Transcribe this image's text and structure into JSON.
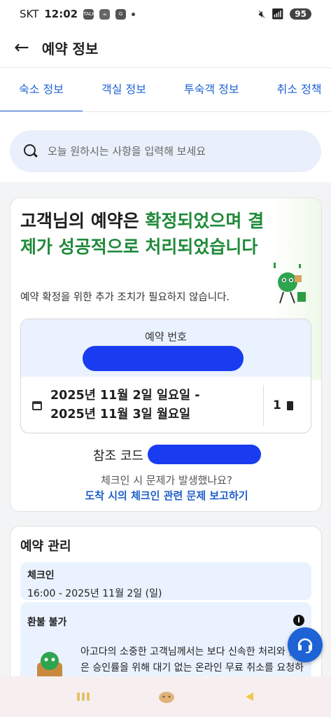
{
  "status_bar": {
    "carrier": "SKT",
    "time": "12:02",
    "talk_icon": "TALK",
    "battery": "95"
  },
  "appbar": {
    "title": "예약 정보"
  },
  "tabs": [
    {
      "label": "숙소 정보",
      "active": true
    },
    {
      "label": "객실 정보",
      "active": false
    },
    {
      "label": "투숙객 정보",
      "active": false
    },
    {
      "label": "취소 정책",
      "active": false
    }
  ],
  "search": {
    "placeholder": "오늘 원하시는 사항을 입력해 보세요"
  },
  "confirmation": {
    "headline_prefix": "고객님의 예약은 ",
    "headline_highlight": "확정되었으며 결제가 성공적으로 처리되었습니다",
    "subtitle": "예약 확정을 위한 추가 조치가 필요하지 않습니다.",
    "reservation_number_label": "예약 번호",
    "date_from": "2025년 11월 2일 일요일 -",
    "date_to": "2025년 11월 3일 월요일",
    "rooms": "1",
    "ref_code_label": "참조 코드",
    "checkin_question": "체크인 시 문제가 발생했나요?",
    "report_link": "도착 시의 체크인 관련 문제 보고하기"
  },
  "management": {
    "title": "예약 관리",
    "checkin_title": "체크인",
    "checkin_value": "16:00 - 2025년 11월 2일 (일)",
    "refund_title": "환불 불가",
    "refund_message": "아고다의 소중한 고객님께서는 보다 신속한 처리와 높은 승인률을 위해 대기 없는 온라인 무료 취소를 요청하실 수 있습니다."
  },
  "colors": {
    "accent": "#1e63d6",
    "green": "#1f8a3a",
    "redaction": "#1a3cf0"
  },
  "icons": [
    "back-arrow-icon",
    "search-icon",
    "calendar-icon",
    "door-icon",
    "info-icon",
    "headset-icon",
    "recent-apps-icon",
    "home-icon",
    "back-nav-icon"
  ]
}
